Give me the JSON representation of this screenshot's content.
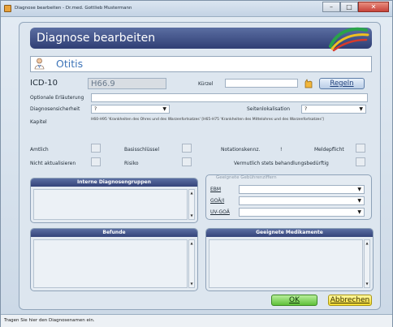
{
  "window": {
    "title": "Diagnose bearbeiten - Dr.med. Gottlieb Mustermann",
    "close_label": "✕"
  },
  "header": {
    "title": "Diagnose bearbeiten"
  },
  "diagnosis": {
    "name": "Otitis"
  },
  "icd": {
    "label": "ICD-10",
    "code": "H66.9"
  },
  "kuerzel": {
    "label": "Kürzel",
    "value": ""
  },
  "buttons": {
    "regeln": "Regeln",
    "ok": "OK",
    "abbrechen": "Abbrechen"
  },
  "optional": {
    "label": "Optionale Erläuterung",
    "value": ""
  },
  "sicherheit": {
    "label": "Diagnosensicherheit",
    "value": "?"
  },
  "seite": {
    "label": "Seitenlokalisation",
    "value": "?"
  },
  "kapitel": {
    "label": "Kapitel",
    "text": "H60-H95 'Krankheiten des Ohres und des Warzenfortsatzes' [H65-H75 'Krankheiten des Mittelohres und des Warzenfortsatzes']"
  },
  "flags": {
    "amtlich": "Amtlich",
    "basisschluessel": "Basisschlüssel",
    "notationskennz": "Notationskennz.",
    "notationskennz_value": "!",
    "meldepflicht": "Meldepflicht",
    "nicht_aktualisieren": "Nicht aktualisieren",
    "risiko": "Risiko",
    "vermutlich": "Vermutlich stets behandlungsbedürftig"
  },
  "panels": {
    "interne": "Interne Diagnosengruppen",
    "gebuehren": "Geeignete Gebührenziffern",
    "befunde": "Befunde",
    "medikamente": "Geeignete Medikamente"
  },
  "gebuehren": {
    "ebm": "EBM",
    "goae": "GOÄ/I",
    "uvgoae": "UV-GOÄ"
  },
  "status": {
    "text": "Tragen Sie hier den Diagnosenamen ein."
  }
}
